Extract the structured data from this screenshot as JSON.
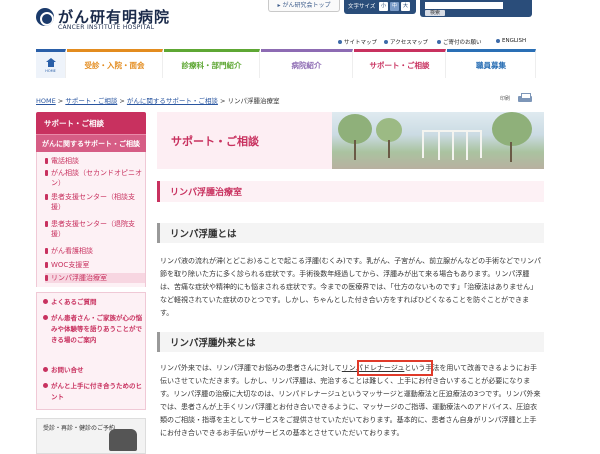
{
  "header": {
    "logo_jp": "がん研有明病院",
    "logo_en": "CANCER INSTITUTE HOSPITAL",
    "top_link": "がん研究会トップ",
    "font_size_label": "文字サイズ",
    "font_size_buttons": [
      "小",
      "中",
      "大"
    ],
    "search_placeholder": "",
    "search_button": "検索",
    "util_links": [
      "サイトマップ",
      "アクセスマップ",
      "ご寄付のお願い",
      "ENGLISH"
    ]
  },
  "nav": {
    "home": "HOME",
    "items": [
      "受診・入院・面会",
      "診療科・部門紹介",
      "病院紹介",
      "サポート・ご相談",
      "職員募集"
    ],
    "colors": [
      "#e38c1f",
      "#5ea734",
      "#8d6bb3",
      "#c8315f",
      "#2a6fb5"
    ]
  },
  "breadcrumb": {
    "items": [
      "HOME",
      "サポート・ご相談",
      "がんに関するサポート・ご相談",
      "リンパ浮腫治療室"
    ],
    "separator": " > "
  },
  "print_label": "印刷",
  "sidebar": {
    "title": "サポート・ご相談",
    "subtitle": "がんに関するサポート・ご相談",
    "links": [
      "電話相談",
      "がん相談（セカンドオピニオン）",
      "患者支援センター（相談支援）",
      "患者支援センター（退院支援）",
      "がん看護相談",
      "WOC支援室",
      "リンパ浮腫治療室"
    ],
    "links2": [
      "よくあるご質問",
      "がん患者さん・ご家族が心の悩みや体験等を語りあうことができる場のご案内",
      "お問い合せ",
      "がんと上手に付き合うためのヒント"
    ],
    "phone_text": "受診・再診・健診のご予約"
  },
  "main": {
    "banner_title": "サポート・ご相談",
    "section_title": "リンパ浮腫治療室",
    "h2_1": "リンパ浮腫とは",
    "p1": "リンパ液の流れが滞(とどこお)ることで起こる浮腫(むくみ)です。乳がん、子宮がん、前立腺がんなどの手術などでリンパ節を取り除いた方に多く診られる症状です。手術後数年経過してから、浮腫みが出て来る場合もあります。リンパ浮腫は、苦痛な症状や精神的にも悩まされる症状です。今までの医療界では、「仕方のないものです」「治療法はありません」など軽視されていた症状のひとつです。しかし、ちゃんとした付き合い方をすればひどくなることを防ぐことができます。",
    "h2_2": "リンパ浮腫外来とは",
    "p2_a": "リンパ外来では、リンパ浮腫でお悩みの患者さんに対して",
    "p2_highlight": "リンパドレナージュ",
    "p2_b": "という手法を用いて改善できるようにお手伝いさせていただきます。しかし、リンパ浮腫は、完治することは難しく、上手にお付き合いすることが必要になります。リンパ浮腫の治療に大切なのは、リンパドレナージュというマッサージと運動療法と圧迫療法の3つです。リンパ外来では、患者さんが上手くリンパ浮腫とお付き合いできるように、マッサージのご指導、運動療法へのアドバイス、圧迫衣類のご相談・指導を主としてサービスをご提供させていただいております。基本的に、患者さん自身がリンパ浮腫と上手にお付き合いできるお手伝いがサービスの基本とさせていただいております。"
  }
}
